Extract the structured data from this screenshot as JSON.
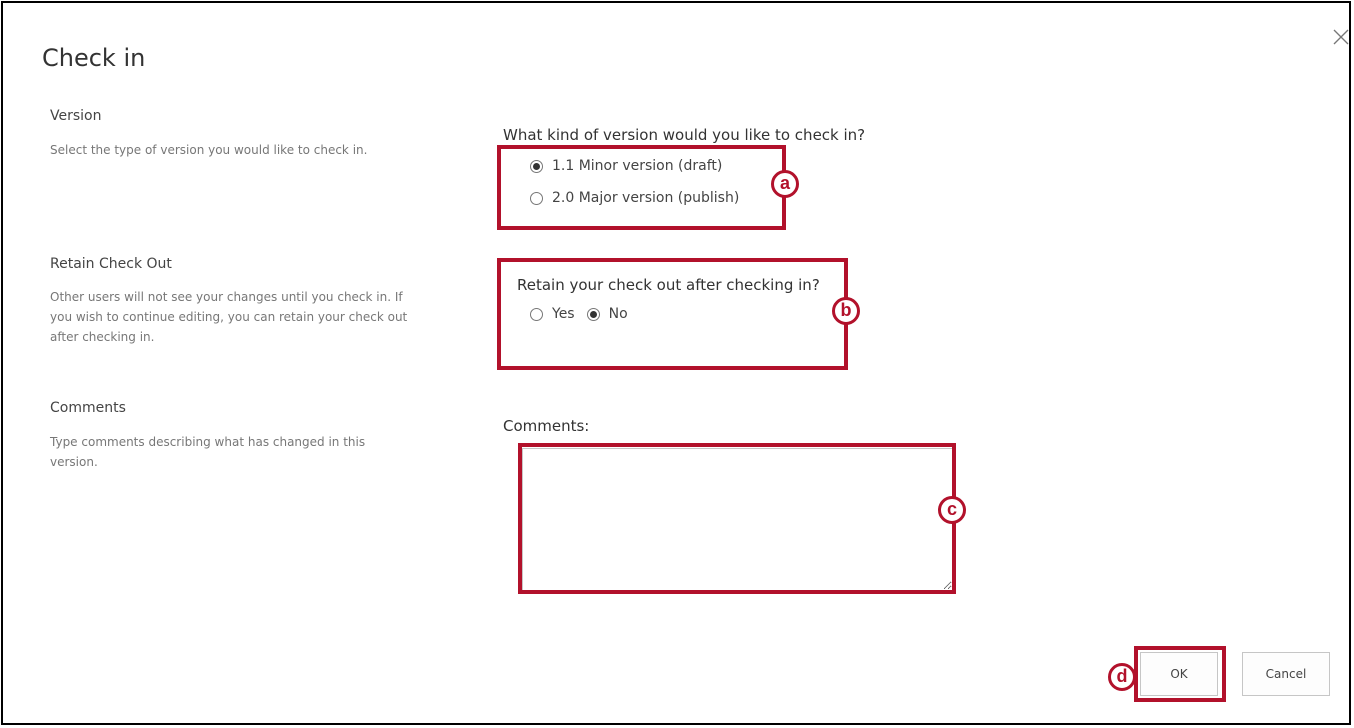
{
  "dialog": {
    "title": "Check in",
    "close_icon": "close-icon"
  },
  "version_section": {
    "heading": "Version",
    "description": "Select the type of version you would like to check in.",
    "question": "What kind of version would you like to check in?",
    "options": [
      {
        "label": "1.1 Minor version (draft)",
        "selected": true
      },
      {
        "label": "2.0 Major version (publish)",
        "selected": false
      }
    ]
  },
  "retain_section": {
    "heading": "Retain Check Out",
    "description_lines": [
      "Other users will not see your changes until you check in. If",
      "you wish to continue editing, you can retain your check out",
      "after checking in."
    ],
    "question": "Retain your check out after checking in?",
    "options": [
      {
        "label": "Yes",
        "selected": false
      },
      {
        "label": "No",
        "selected": true
      }
    ]
  },
  "comments_section": {
    "heading": "Comments",
    "description_lines": [
      "Type comments describing what has changed in this",
      "version."
    ],
    "field_label": "Comments:",
    "value": ""
  },
  "buttons": {
    "ok": "OK",
    "cancel": "Cancel"
  },
  "annotations": {
    "a": "a",
    "b": "b",
    "c": "c",
    "d": "d",
    "color": "#b2112b"
  }
}
